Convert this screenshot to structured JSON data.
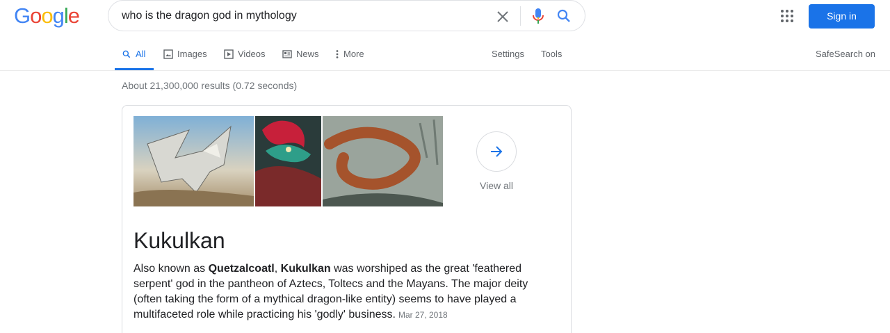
{
  "logo": {
    "letters": [
      "G",
      "o",
      "o",
      "g",
      "l",
      "e"
    ],
    "colors": [
      "#4285f4",
      "#ea4335",
      "#fbbc05",
      "#4285f4",
      "#34a853",
      "#ea4335"
    ]
  },
  "search": {
    "query": "who is the dragon god in mythology"
  },
  "header": {
    "signin_label": "Sign in"
  },
  "tabs": [
    {
      "label": "All",
      "icon": "search-icon",
      "active": true
    },
    {
      "label": "Images",
      "icon": "image-icon"
    },
    {
      "label": "Videos",
      "icon": "video-icon"
    },
    {
      "label": "News",
      "icon": "news-icon"
    },
    {
      "label": "More",
      "icon": "more-vert-icon"
    }
  ],
  "tools": {
    "settings_label": "Settings",
    "tools_label": "Tools",
    "safesearch_label": "SafeSearch on"
  },
  "results": {
    "stats": "About 21,300,000 results (0.72 seconds)"
  },
  "knowledge_panel": {
    "images": [
      "dragon-image-white",
      "dragon-image-feathered",
      "dragon-image-serpent"
    ],
    "view_all_label": "View all",
    "title": "Kukulkan",
    "desc_part1": "Also known as ",
    "desc_bold1": "Quetzalcoatl",
    "desc_part2": ", ",
    "desc_bold2": "Kukulkan",
    "desc_part3": " was worshiped as the great 'feathered serpent' god in the pantheon of Aztecs, Toltecs and the Mayans. The major deity (often taking the form of a mythical dragon-like entity) seems to have played a multifaceted role while practicing his 'godly' business.",
    "date": "Mar 27, 2018"
  },
  "colors": {
    "accent": "#1a73e8",
    "muted": "#70757a"
  }
}
